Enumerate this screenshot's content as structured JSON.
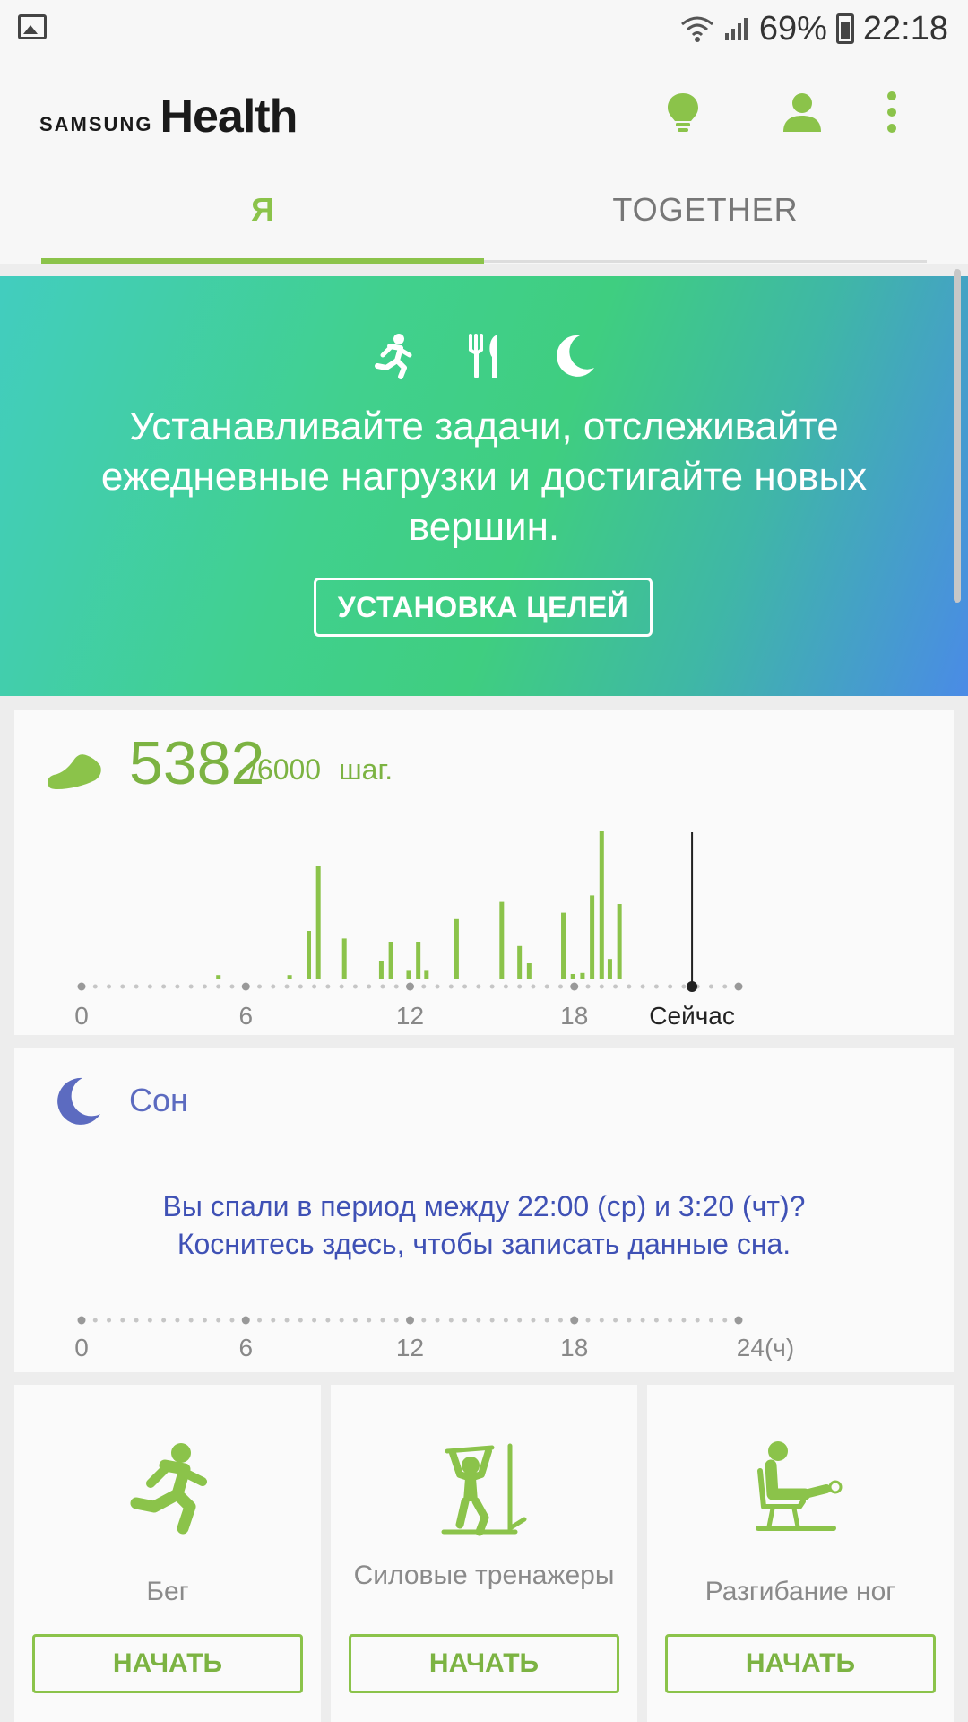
{
  "status_bar": {
    "battery": "69%",
    "time": "22:18"
  },
  "header": {
    "logo_samsung": "SAMSUNG",
    "logo_health": "Health"
  },
  "tabs": [
    {
      "label": "Я"
    },
    {
      "label": "TOGETHER"
    }
  ],
  "hero": {
    "text": "Устанавливайте задачи, отслеживайте ежедневные нагрузки и достигайте новых вершин.",
    "button": "УСТАНОВКА ЦЕЛЕЙ"
  },
  "steps": {
    "count": "5382",
    "goal": "/6000",
    "unit": "шаг.",
    "axis_labels": [
      "0",
      "6",
      "12",
      "18"
    ],
    "now_label": "Сейчас",
    "now_hour": 22.3,
    "bar_hours": [
      5.0,
      7.6,
      8.3,
      8.65,
      9.6,
      10.95,
      11.3,
      11.95,
      12.3,
      12.6,
      13.7,
      15.35,
      16.0,
      16.35,
      17.6,
      17.95,
      18.3,
      18.65,
      19.0,
      19.3,
      19.65
    ],
    "bar_values": [
      4,
      4,
      45,
      105,
      38,
      17,
      35,
      8,
      35,
      8,
      56,
      72,
      31,
      15,
      62,
      5,
      6,
      78,
      138,
      19,
      70
    ],
    "max_value": 150
  },
  "sleep": {
    "title": "Сон",
    "message_line1": "Вы спали в период между 22:00 (ср) и 3:20 (чт)?",
    "message_line2": "Коснитесь здесь, чтобы записать данные сна.",
    "axis_labels": [
      "0",
      "6",
      "12",
      "18"
    ],
    "axis_end": "24(ч)"
  },
  "exercises": [
    {
      "label": "Бег",
      "icon": "running-icon",
      "button": "НАЧАТЬ"
    },
    {
      "label": "Силовые тренажеры",
      "icon": "strength-machine-icon",
      "button": "НАЧАТЬ"
    },
    {
      "label": "Разгибание ног",
      "icon": "leg-extension-icon",
      "button": "НАЧАТЬ"
    }
  ],
  "colors": {
    "accent": "#8bc34a",
    "sleep": "#5c6bc0"
  }
}
